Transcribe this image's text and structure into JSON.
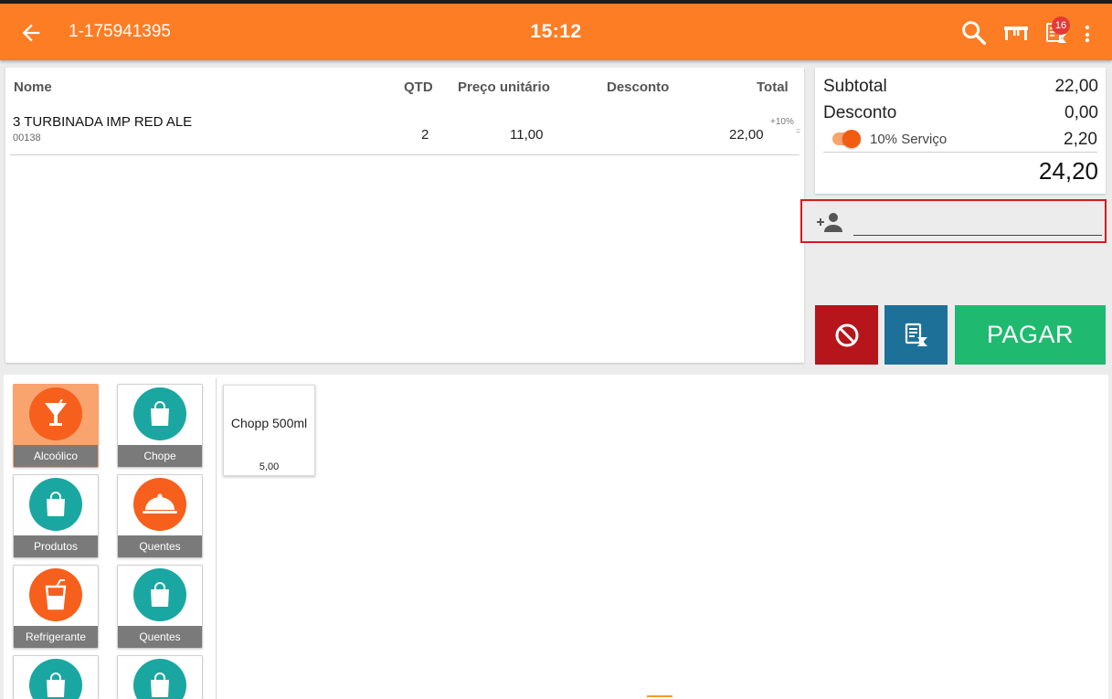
{
  "header": {
    "order_id": "1-175941395",
    "time": "15:12",
    "notification_count": "16"
  },
  "table": {
    "columns": {
      "name": "Nome",
      "qty": "QTD",
      "unit_price": "Preço unitário",
      "discount": "Desconto",
      "total": "Total"
    },
    "items": [
      {
        "name": "3 TURBINADA IMP RED ALE",
        "code": "00138",
        "qty": "2",
        "unit_price": "11,00",
        "discount": "",
        "total": "22,00",
        "tax": "+10%",
        "tax_suffix": "="
      }
    ]
  },
  "summary": {
    "subtotal_label": "Subtotal",
    "subtotal": "22,00",
    "discount_label": "Desconto",
    "discount": "0,00",
    "service_label": "10% Serviço",
    "service_enabled": true,
    "service": "2,20",
    "total": "24,20"
  },
  "customer": {
    "value": "",
    "placeholder": ""
  },
  "actions": {
    "pay_label": "PAGAR"
  },
  "categories": [
    {
      "label": "Alcoólico",
      "icon": "cocktail-icon",
      "color": "#f6601c",
      "active": true
    },
    {
      "label": "Chope",
      "icon": "shopping-bag-icon",
      "color": "#1aa7a2"
    },
    {
      "label": "Produtos",
      "icon": "shopping-bag-icon",
      "color": "#1aa7a2"
    },
    {
      "label": "Quentes",
      "icon": "food-cloche-icon",
      "color": "#f6601c"
    },
    {
      "label": "Refrigerante",
      "icon": "soft-drink-icon",
      "color": "#f6601c"
    },
    {
      "label": "Quentes",
      "icon": "shopping-bag-icon",
      "color": "#1aa7a2"
    },
    {
      "label": "",
      "icon": "shopping-bag-icon",
      "color": "#1aa7a2"
    },
    {
      "label": "",
      "icon": "shopping-bag-icon",
      "color": "#1aa7a2"
    }
  ],
  "products": [
    {
      "name": "Chopp 500ml",
      "price": "5,00"
    }
  ],
  "colors": {
    "primary": "#fd7d24",
    "cancel": "#b5151b",
    "wait": "#1d7199",
    "pay": "#1fba70",
    "highlight_border": "#d61b1b",
    "teal": "#1aa7a2",
    "orange": "#f6601c"
  }
}
